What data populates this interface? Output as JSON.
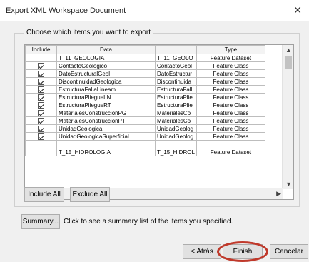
{
  "window": {
    "title": "Export XML Workspace Document",
    "close_glyph": "✕"
  },
  "group": {
    "label": "Choose which items you want to export"
  },
  "grid": {
    "columns": [
      "Include",
      "Data",
      "",
      "Type"
    ],
    "rows": [
      {
        "checked": false,
        "show_checkbox": false,
        "data": "T_11_GEOLOGIA",
        "name": "T_11_GEOLO",
        "type": "Feature Dataset"
      },
      {
        "checked": true,
        "show_checkbox": true,
        "data": "ContactoGeologico",
        "name": "ContactoGeol",
        "type": "Feature Class"
      },
      {
        "checked": true,
        "show_checkbox": true,
        "data": "DatoEstructuralGeol",
        "name": "DatoEstructur",
        "type": "Feature Class"
      },
      {
        "checked": true,
        "show_checkbox": true,
        "data": "DiscontinuidadGeologica",
        "name": "Discontinuida",
        "type": "Feature Class"
      },
      {
        "checked": true,
        "show_checkbox": true,
        "data": "EstructuraFallaLineam",
        "name": "EstructuraFall",
        "type": "Feature Class"
      },
      {
        "checked": true,
        "show_checkbox": true,
        "data": "EstructuraPliegueLN",
        "name": "EstructuraPlie",
        "type": "Feature Class"
      },
      {
        "checked": true,
        "show_checkbox": true,
        "data": "EstructuraPliegueRT",
        "name": "EstructuraPlie",
        "type": "Feature Class"
      },
      {
        "checked": true,
        "show_checkbox": true,
        "data": "MaterialesConstruccionPG",
        "name": "MaterialesCo",
        "type": "Feature Class"
      },
      {
        "checked": true,
        "show_checkbox": true,
        "data": "MaterialesConstruccionPT",
        "name": "MaterialesCo",
        "type": "Feature Class"
      },
      {
        "checked": true,
        "show_checkbox": true,
        "data": "UnidadGeologica",
        "name": "UnidadGeolog",
        "type": "Feature Class"
      },
      {
        "checked": true,
        "show_checkbox": true,
        "data": "UnidadGeologicaSuperficial",
        "name": "UnidadGeolog",
        "type": "Feature Class"
      },
      {
        "checked": false,
        "show_checkbox": false,
        "data": "",
        "name": "",
        "type": ""
      },
      {
        "checked": false,
        "show_checkbox": false,
        "data": "T_15_HIDROLOGIA",
        "name": "T_15_HIDROL",
        "type": "Feature Dataset"
      }
    ]
  },
  "scroll": {
    "up": "▲",
    "down": "▼",
    "left": "◀",
    "right": "▶"
  },
  "buttons": {
    "include_all": "Include All",
    "exclude_all": "Exclude All",
    "summary": "Summary...",
    "back": "< Atrás",
    "finish": "Finish",
    "cancel": "Cancelar"
  },
  "hint": "Click to see a summary list of the items you specified.",
  "colors": {
    "highlight": "#f6c79a",
    "finish_ring": "#c0392b"
  }
}
